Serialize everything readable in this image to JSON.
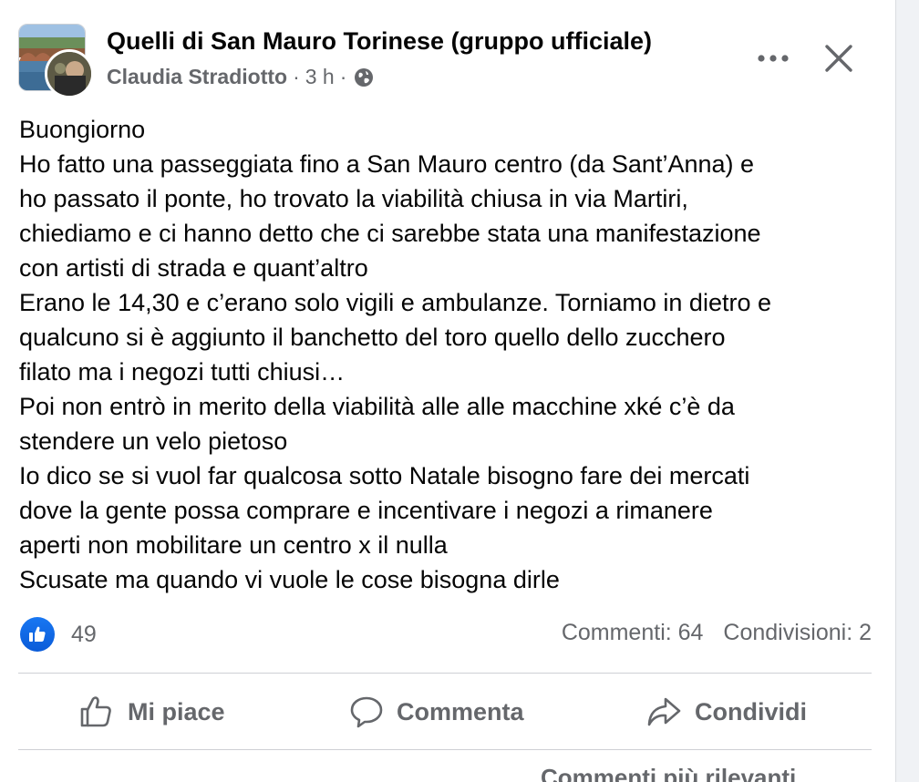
{
  "header": {
    "group_name": "Quelli di San Mauro Torinese (gruppo ufficiale)",
    "author": "Claudia Stradiotto",
    "time": "3 h",
    "separator": "·",
    "privacy_icon": "globe-icon"
  },
  "post": {
    "lines": [
      "Buongiorno",
      "Ho fatto una passeggiata fino a San Mauro centro (da Sant’Anna) e",
      "ho passato il ponte, ho trovato la viabilità chiusa in via Martiri,",
      "chiediamo e ci hanno detto che ci sarebbe stata una manifestazione",
      "con artisti di strada e quant’altro",
      "Erano le 14,30 e c’erano solo vigili e ambulanze. Torniamo in dietro e",
      "qualcuno si è aggiunto il banchetto del toro quello dello zucchero",
      "filato ma i negozi tutti chiusi…",
      "Poi non entrò in merito della viabilità alle alle macchine xké c’è da",
      "stendere un velo pietoso",
      "Io dico se si vuol far qualcosa sotto Natale bisogno fare dei mercati",
      "dove la gente possa comprare e incentivare i negozi a rimanere",
      "aperti non mobilitare un centro x il nulla",
      "Scusate ma quando vi vuole le cose bisogna dirle"
    ]
  },
  "stats": {
    "likes": "49",
    "comments": "Commenti: 64",
    "shares": "Condivisioni: 2"
  },
  "actions": {
    "like": "Mi piace",
    "comment": "Commenta",
    "share": "Condividi"
  },
  "comments_sort": {
    "label": "Commenti più rilevanti"
  },
  "colors": {
    "accent": "#1877f2",
    "secondary_text": "#65676b",
    "primary_text": "#050505"
  }
}
